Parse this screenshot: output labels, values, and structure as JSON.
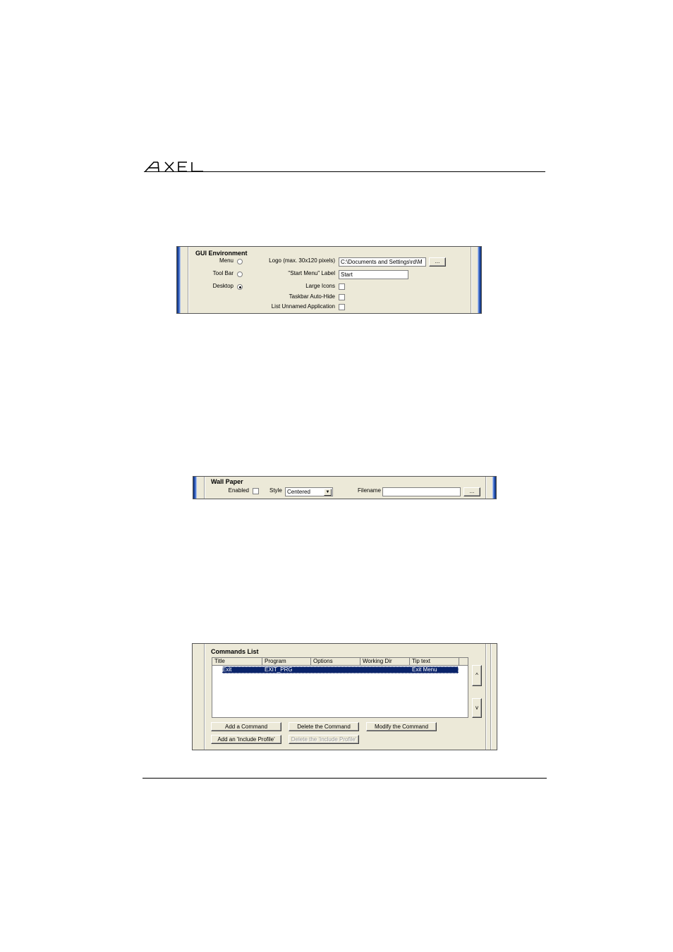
{
  "header": {
    "logo_text": "AXEL"
  },
  "gui_environment": {
    "title": "GUI Environment",
    "modes": [
      {
        "label": "Menu",
        "selected": false
      },
      {
        "label": "Tool Bar",
        "selected": false
      },
      {
        "label": "Desktop",
        "selected": true
      }
    ],
    "logo_label": "Logo (max. 30x120 pixels)",
    "logo_value": "C:\\Documents and Settings\\rd\\M",
    "browse_label": "...",
    "start_menu_label": "\"Start Menu\" Label",
    "start_menu_value": "Start",
    "options": [
      {
        "label": "Large Icons",
        "checked": false
      },
      {
        "label": "Taskbar Auto-Hide",
        "checked": false
      },
      {
        "label": "List Unnamed Application",
        "checked": false
      }
    ]
  },
  "wall_paper": {
    "title": "Wall Paper",
    "enabled_label": "Enabled",
    "enabled_checked": false,
    "style_label": "Style",
    "style_value": "Centered",
    "filename_label": "Filename",
    "filename_value": "",
    "browse_label": "..."
  },
  "commands_list": {
    "title": "Commands List",
    "columns": [
      "Title",
      "Program",
      "Options",
      "Working Dir",
      "Tip text"
    ],
    "rows": [
      {
        "title": "Exit",
        "program": "EXIT_PRG",
        "options": "",
        "working_dir": "",
        "tip_text": "Exit Menu",
        "selected": true
      }
    ],
    "up_label": "^",
    "down_label": "v",
    "buttons": {
      "add_command": "Add a Command",
      "delete_command": "Delete the Command",
      "modify_command": "Modify the Command",
      "add_include": "Add an 'Include Profile'",
      "delete_include": "Delete the 'Include Profile'"
    }
  }
}
